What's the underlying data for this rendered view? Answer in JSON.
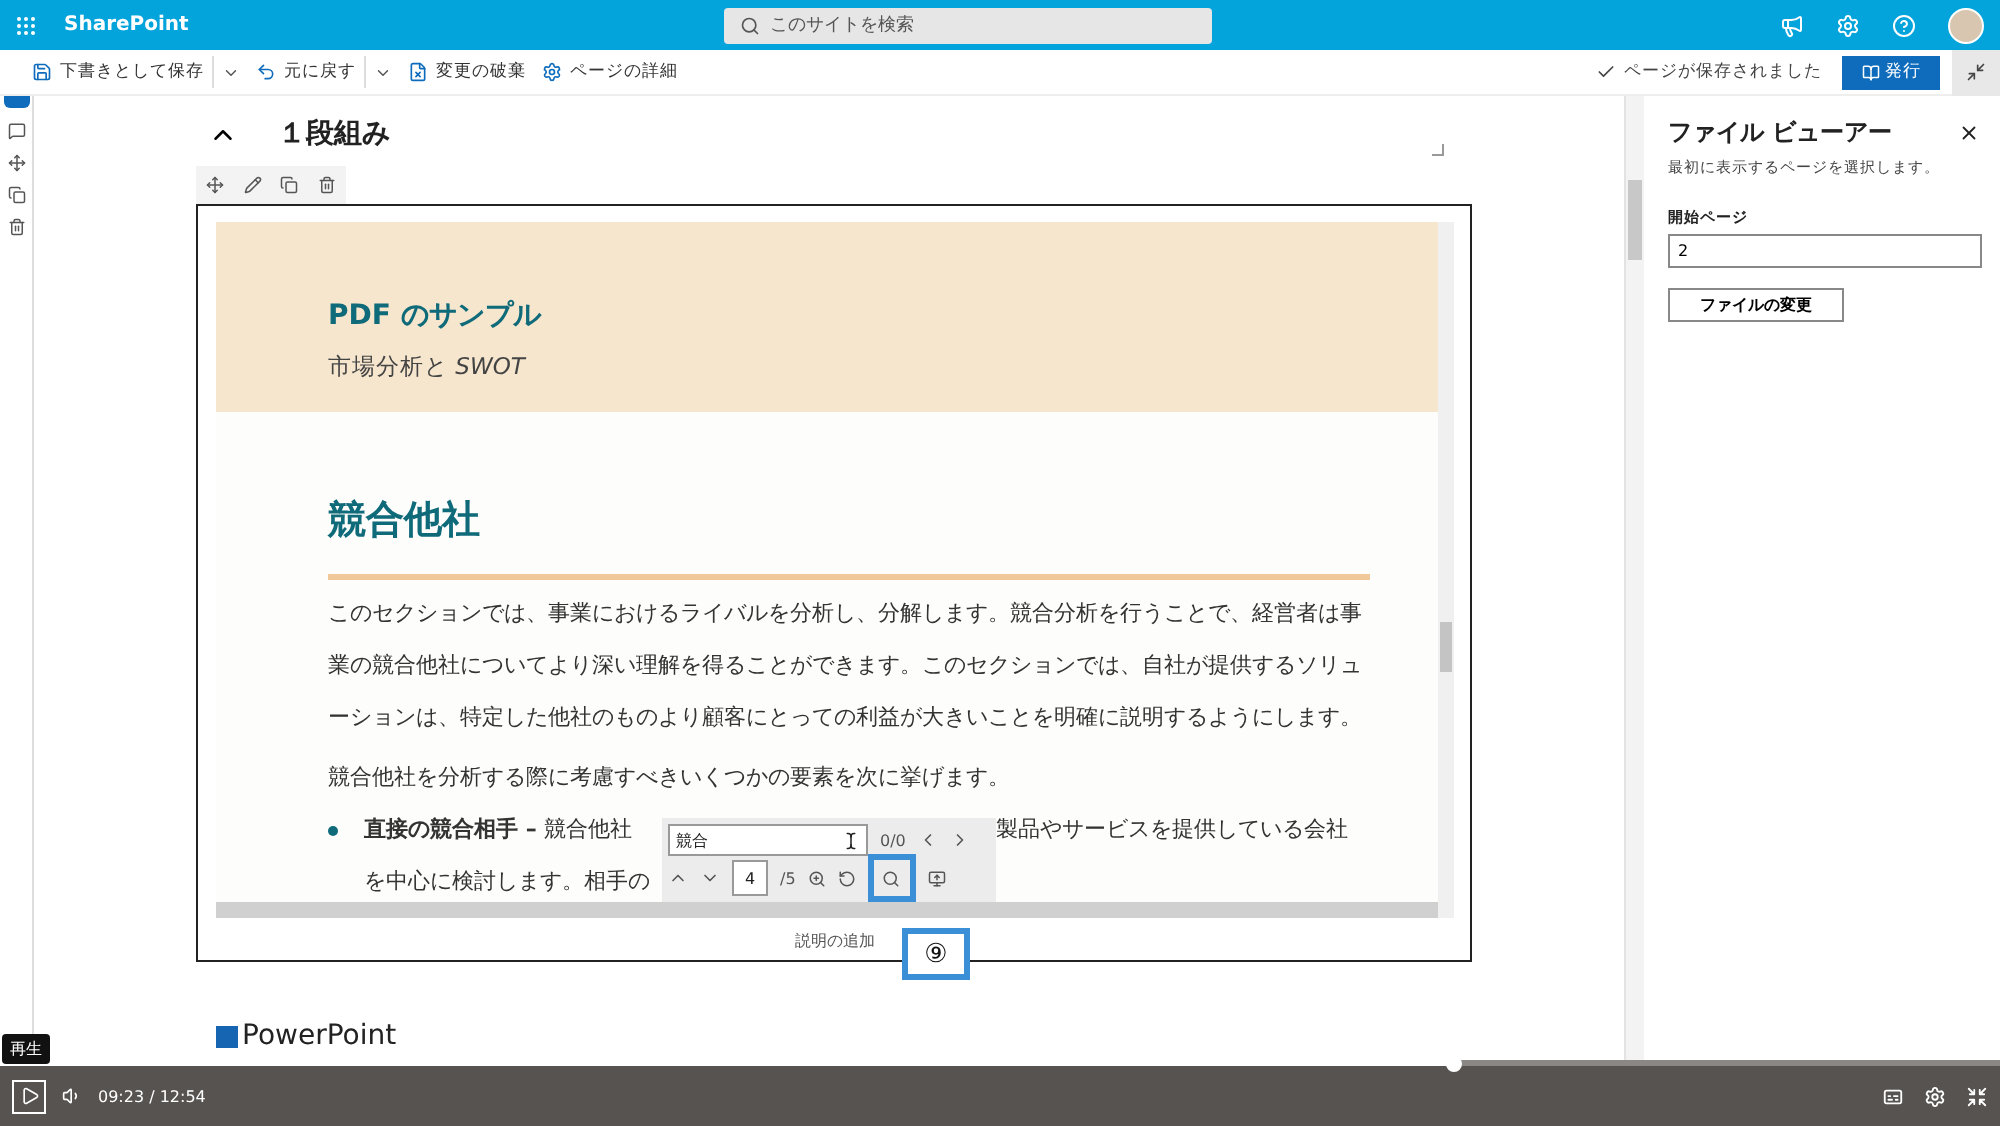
{
  "top_bar": {
    "app_name": "SharePoint",
    "search": {
      "placeholder": "このサイトを検索"
    }
  },
  "command_bar": {
    "actions": [
      {
        "label": "下書きとして保存",
        "kind": "save",
        "dropdown": true
      },
      {
        "label": "元に戻す",
        "kind": "undo",
        "dropdown": true
      },
      {
        "label": "変更の破棄",
        "kind": "discard",
        "dropdown": false
      },
      {
        "label": "ページの詳細",
        "kind": "details",
        "dropdown": false
      }
    ],
    "status": "ページが保存されました",
    "publish_button": "発行"
  },
  "canvas": {
    "section_title": "１段組み",
    "caption_placeholder": "説明の追加",
    "next_heading": "PowerPoint"
  },
  "pdf": {
    "banner_title": "PDF のサンプル",
    "banner_subtitle": "市場分析と *SWOT*",
    "heading": "競合他社",
    "paragraphs": [
      "このセクションでは、事業におけるライバルを分析し、分解します。競合分析を行うことで、経営者は事業の競合他社についてより深い理解を得ることができます。このセクションでは、自社が提供するソリューションは、特定した他社のものより顧客にとっての利益が大きいことを明確に説明するようにします。",
      "競合他社を分析する際に考慮すべきいくつかの要素を次に挙げます。"
    ],
    "bullets": [
      {
        "lead": "直接の競合相手 –",
        "line_1_start": "競合他社",
        "line_1_end": "製品やサービスを提供している会社",
        "line_2_start": "を中心に検討します。相手の"
      }
    ]
  },
  "pdf_toolbar": {
    "search_value": "競合",
    "match_count": "0/0",
    "page_value": "4",
    "page_total": "/5"
  },
  "annotation": {
    "label": "⑨"
  },
  "side_panel": {
    "title": "ファイル ビューアー",
    "description": "最初に表示するページを選択します。",
    "field_label": "開始ページ",
    "field_value": "2",
    "button": "ファイルの変更"
  },
  "video": {
    "tooltip": "再生",
    "time": "09:23 / 12:54",
    "level": 0.727
  }
}
